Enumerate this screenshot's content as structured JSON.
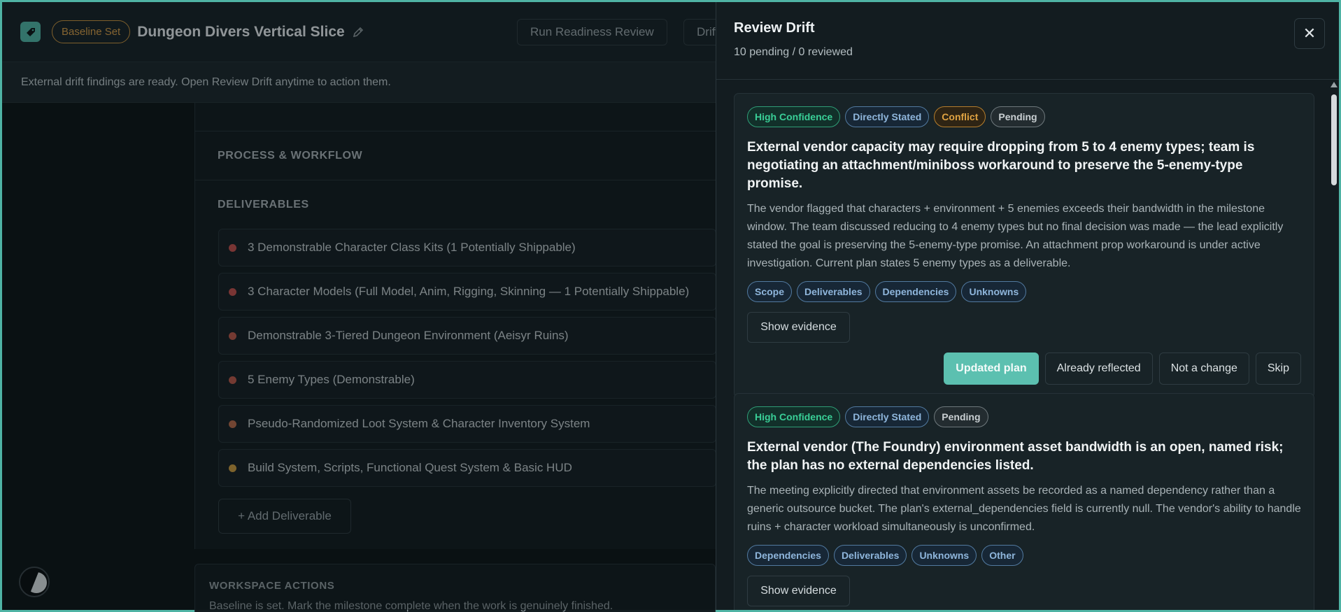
{
  "header": {
    "baseline_badge": "Baseline Set",
    "project_title": "Dungeon Divers Vertical Slice",
    "run_review_button": "Run Readiness Review",
    "drift_button": "Drift"
  },
  "banner": {
    "message": "External drift findings are ready. Open Review Drift anytime to action them."
  },
  "sections": {
    "process": "PROCESS & WORKFLOW",
    "deliverables": "DELIVERABLES"
  },
  "deliverables": [
    {
      "label": "3 Demonstrable Character Class Kits (1 Potentially Shippable)",
      "color": "#c0504d"
    },
    {
      "label": "3 Character Models (Full Model, Anim, Rigging, Skinning — 1 Potentially Shippable)",
      "color": "#c0504d"
    },
    {
      "label": "Demonstrable 3-Tiered Dungeon Environment (Aeisyr Ruins)",
      "color": "#b9584a"
    },
    {
      "label": "5 Enemy Types (Demonstrable)",
      "color": "#b9584a"
    },
    {
      "label": "Pseudo-Randomized Loot System & Character Inventory System",
      "color": "#b56a4a"
    },
    {
      "label": "Build System, Scripts, Functional Quest System & Basic HUD",
      "color": "#c99a3f"
    }
  ],
  "add_deliverable": "+ Add Deliverable",
  "workspace": {
    "title": "WORKSPACE ACTIONS",
    "text": "Baseline is set. Mark the milestone complete when the work is genuinely finished."
  },
  "drawer": {
    "title": "Review Drift",
    "subtitle": "10 pending / 0 reviewed",
    "close": "✕"
  },
  "findings": [
    {
      "badges": [
        {
          "text": "High Confidence",
          "style": "green"
        },
        {
          "text": "Directly Stated",
          "style": "blue"
        },
        {
          "text": "Conflict",
          "style": "orange"
        },
        {
          "text": "Pending",
          "style": "gray"
        }
      ],
      "title": "External vendor capacity may require dropping from 5 to 4 enemy types; team is negotiating an attachment/miniboss workaround to preserve the 5-enemy-type promise.",
      "body": "The vendor flagged that characters + environment + 5 enemies exceeds their bandwidth in the milestone window. The team discussed reducing to 4 enemy types but no final decision was made — the lead explicitly stated the goal is preserving the 5-enemy-type promise. An attachment prop workaround is under active investigation. Current plan states 5 enemy types as a deliverable.",
      "tags": [
        "Scope",
        "Deliverables",
        "Dependencies",
        "Unknowns"
      ],
      "evidence": "Show evidence",
      "actions": [
        "Updated plan",
        "Already reflected",
        "Not a change",
        "Skip"
      ]
    },
    {
      "badges": [
        {
          "text": "High Confidence",
          "style": "green"
        },
        {
          "text": "Directly Stated",
          "style": "blue"
        },
        {
          "text": "Pending",
          "style": "gray"
        }
      ],
      "title": "External vendor (The Foundry) environment asset bandwidth is an open, named risk; the plan has no external dependencies listed.",
      "body": "The meeting explicitly directed that environment assets be recorded as a named dependency rather than a generic outsource bucket. The plan's external_dependencies field is currently null. The vendor's ability to handle ruins + character workload simultaneously is unconfirmed.",
      "tags": [
        "Dependencies",
        "Deliverables",
        "Unknowns",
        "Other"
      ],
      "evidence": "Show evidence"
    }
  ]
}
